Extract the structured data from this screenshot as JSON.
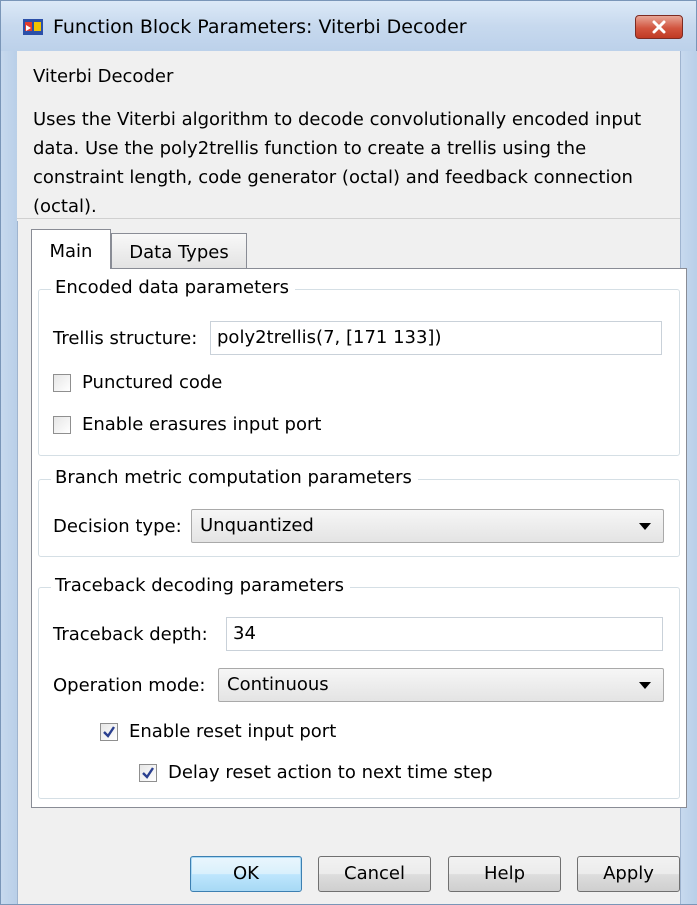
{
  "window": {
    "title": "Function Block Parameters: Viterbi Decoder",
    "accent": "#c7d9ee",
    "close_color": "#c03a24"
  },
  "description": {
    "title": "Viterbi Decoder",
    "lines": [
      "Uses the Viterbi algorithm to decode convolutionally encoded input",
      "data.  Use the poly2trellis function to create a trellis using the",
      "constraint length, code generator (octal) and feedback connection",
      "(octal)."
    ]
  },
  "tabs": [
    {
      "label": "Main",
      "selected": true
    },
    {
      "label": "Data Types",
      "selected": false
    }
  ],
  "encoded": {
    "title": "Encoded data parameters",
    "trellis_label": "Trellis structure:",
    "trellis_value": "poly2trellis(7, [171 133])",
    "punctured_label": "Punctured code",
    "punctured_checked": false,
    "erasures_label": "Enable erasures input port",
    "erasures_checked": false
  },
  "branch": {
    "title": "Branch metric computation parameters",
    "decision_label": "Decision type:",
    "decision_value": "Unquantized"
  },
  "traceback": {
    "title": "Traceback decoding parameters",
    "depth_label": "Traceback depth:",
    "depth_value": "34",
    "mode_label": "Operation mode:",
    "mode_value": "Continuous",
    "reset_label": "Enable reset input port",
    "reset_checked": true,
    "delay_label": "Delay reset action to next time step",
    "delay_checked": true
  },
  "buttons": {
    "ok": "OK",
    "cancel": "Cancel",
    "help": "Help",
    "apply": "Apply"
  }
}
